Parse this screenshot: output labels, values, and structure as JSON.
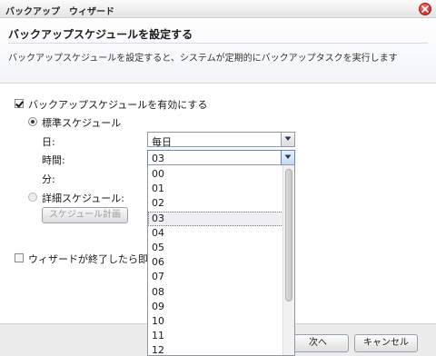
{
  "window": {
    "title": "バックアップ　ウィザード"
  },
  "header": {
    "title": "バックアップスケジュールを設定する",
    "description": "バックアップスケジュールを設定すると、システムが定期的にバックアップタスクを実行します"
  },
  "form": {
    "enable_schedule_label": "バックアップスケジュールを有効にする",
    "enable_schedule_checked": true,
    "standard_schedule_label": "標準スケジュール",
    "day_label": "日:",
    "day_value": "毎日",
    "time_label": "時間:",
    "time_value": "03",
    "minute_label": "分:",
    "detailed_schedule_label": "詳細スケジュール:",
    "schedule_plan_button": "スケジュール計画",
    "run_now_label": "ウィザードが終了したら即座にバ",
    "run_now_checked": false
  },
  "hour_dropdown": {
    "options": [
      "00",
      "01",
      "02",
      "03",
      "04",
      "05",
      "06",
      "07",
      "08",
      "09",
      "10",
      "11",
      "12"
    ],
    "selected": "03"
  },
  "footer": {
    "next_button": "次へ",
    "cancel_button": "キャンセル"
  }
}
